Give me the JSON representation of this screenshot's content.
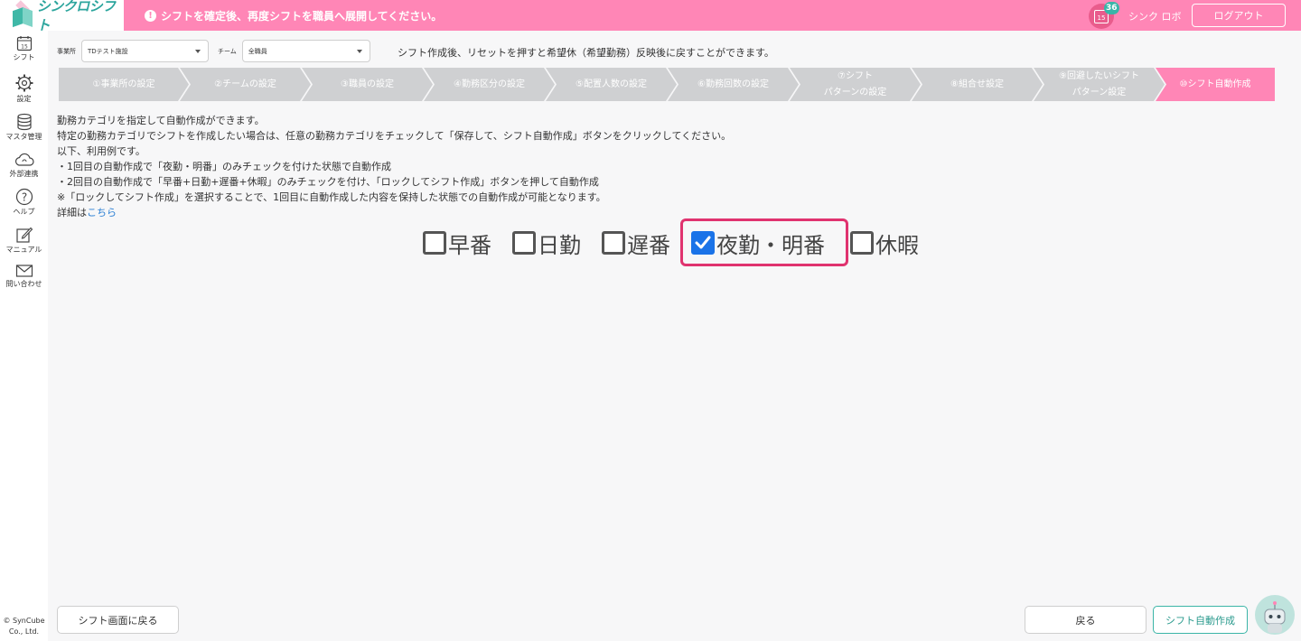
{
  "header": {
    "logo_text": "シンクロシフト",
    "notice": "シフトを確定後、再度シフトを職員へ展開してください。",
    "calendar_day": "15",
    "badge_count": "36",
    "user_name": "シンク ロボ",
    "logout_label": "ログアウト",
    "accent_color": "#ff86b6"
  },
  "sidebar": {
    "items": [
      {
        "label": "シフト",
        "icon": "calendar-icon"
      },
      {
        "label": "設定",
        "icon": "gear-icon"
      },
      {
        "label": "マスタ管理",
        "icon": "database-icon"
      },
      {
        "label": "外部連携",
        "icon": "cloud-icon"
      },
      {
        "label": "ヘルプ",
        "icon": "help-icon"
      },
      {
        "label": "マニュアル",
        "icon": "edit-icon"
      },
      {
        "label": "問い合わせ",
        "icon": "mail-icon"
      }
    ],
    "calendar_day": "15",
    "copyright_line1": "© SynCube",
    "copyright_line2": "Co., Ltd."
  },
  "filters": {
    "office_label": "事業所",
    "office_value": "TDテスト施設",
    "team_label": "チーム",
    "team_value": "全職員",
    "info": "シフト作成後、リセットを押すと希望休（希望勤務）反映後に戻すことができます。"
  },
  "steps": [
    {
      "line1": "①事業所の設定",
      "line2": ""
    },
    {
      "line1": "②チームの設定",
      "line2": ""
    },
    {
      "line1": "③職員の設定",
      "line2": ""
    },
    {
      "line1": "④勤務区分の設定",
      "line2": ""
    },
    {
      "line1": "⑤配置人数の設定",
      "line2": ""
    },
    {
      "line1": "⑥勤務回数の設定",
      "line2": ""
    },
    {
      "line1": "⑦シフト",
      "line2": "パターンの設定"
    },
    {
      "line1": "⑧組合せ設定",
      "line2": ""
    },
    {
      "line1": "⑨回避したいシフト",
      "line2": "パターン設定"
    },
    {
      "line1": "⑩シフト自動作成",
      "line2": ""
    }
  ],
  "active_step": 10,
  "description": {
    "line1": "勤務カテゴリを指定して自動作成ができます。",
    "line2": "特定の勤務カテゴリでシフトを作成したい場合は、任意の勤務カテゴリをチェックして「保存して、シフト自動作成」ボタンをクリックしてください。",
    "line3": "以下、利用例です。",
    "line4": "・1回目の自動作成で「夜勤・明番」のみチェックを付けた状態で自動作成",
    "line5": "・2回目の自動作成で「早番+日勤+遅番+休暇」のみチェックを付け、「ロックしてシフト作成」ボタンを押して自動作成",
    "line6": "※「ロックしてシフト作成」を選択することで、1回目に自動作成した内容を保持した状態での自動作成が可能となります。",
    "details_prefix": "詳細は",
    "details_link": "こちら"
  },
  "categories": [
    {
      "label": "早番",
      "checked": false
    },
    {
      "label": "日勤",
      "checked": false
    },
    {
      "label": "遅番",
      "checked": false
    },
    {
      "label": "夜勤・明番",
      "checked": true
    },
    {
      "label": "休暇",
      "checked": false
    }
  ],
  "buttons": {
    "back_to_shift": "シフト画面に戻る",
    "back": "戻る",
    "auto_create": "シフト自動作成"
  }
}
